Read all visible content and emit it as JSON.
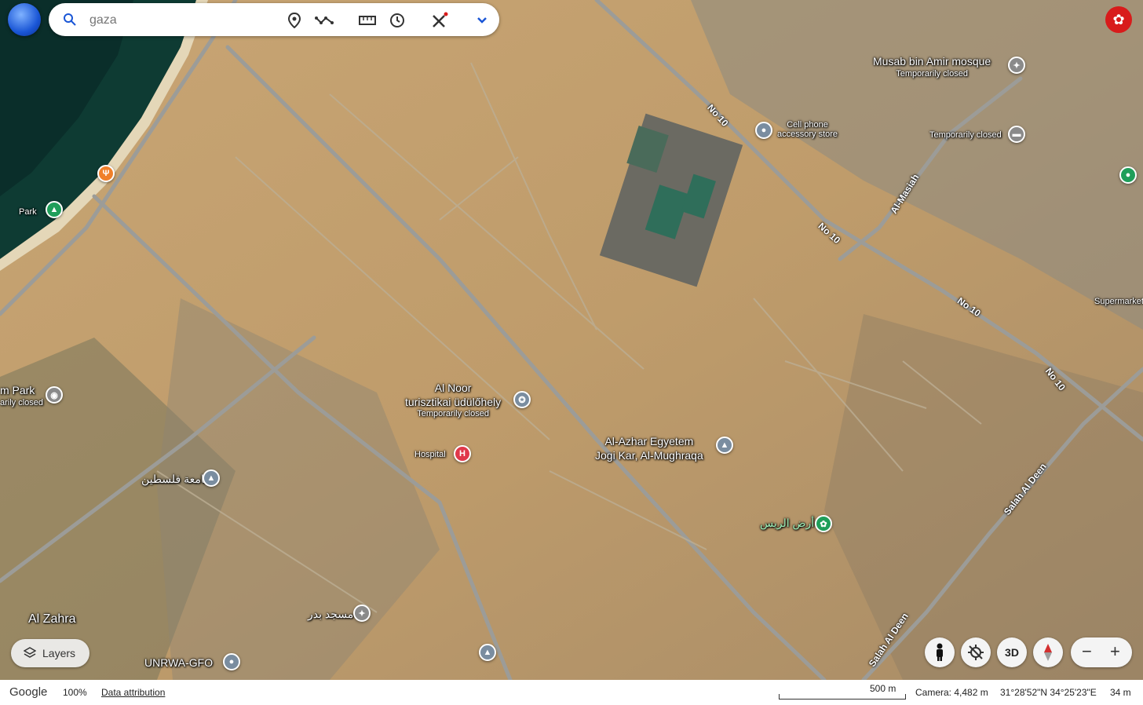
{
  "search": {
    "value": "",
    "placeholder": "gaza"
  },
  "toolbar": {
    "icons": [
      "search-icon",
      "place-pin-icon",
      "path-icon",
      "measure-ruler-icon",
      "history-icon",
      "tools-icon",
      "chevron-down-icon"
    ]
  },
  "account": {
    "avatar_color": "#d81b1b"
  },
  "map": {
    "labels": {
      "musab_mosque": "Musab bin Amir mosque",
      "musab_status": "Temporarily closed",
      "cell_phone_1": "Cell phone",
      "cell_phone_2": "accessory store",
      "temp_closed_2": "Temporarily closed",
      "park": "Park",
      "park_left": "m Park",
      "park_left_status": "arily closed",
      "al_noor_1": "Al Noor",
      "al_noor_2": "turisztikai üdülőhely",
      "al_noor_status": "Temporarily closed",
      "hospital": "Hospital",
      "al_azhar_1": "Al-Azhar Egyetem",
      "al_azhar_2": "Jogi Kar, Al-Mughraqa",
      "palestine_uni": "جامعة فلسطين",
      "ard_alrayyis": "أرض الريس",
      "masjid_badr": "مسجد بدر",
      "al_zahra": "Al Zahra",
      "unrwa": "UNRWA-GFO",
      "supermarket": "Supermarket"
    },
    "roads": {
      "no10_a": "No 10",
      "no10_b": "No 10",
      "no10_c": "No 10",
      "no10_d": "No 10",
      "al_masiah": "Al-Masiah",
      "salah_1": "Salah Al Deen",
      "salah_2": "Salah Al Deen"
    },
    "colors": {
      "sea": "#0e3b33",
      "sand": "#c9a676",
      "road": "#9c9c98",
      "mosque_pin": "#8a8a8a",
      "hospital_pin": "#e0384a",
      "food_pin": "#f0802a",
      "park_pin": "#1f9e5a",
      "school_pin": "#7a8da0"
    }
  },
  "controls": {
    "layers_label": "Layers",
    "view_3d": "3D",
    "zoom_out": "−",
    "zoom_in": "+"
  },
  "status": {
    "brand": "Google",
    "zoom": "100%",
    "attribution": "Data attribution",
    "scale": "500 m",
    "camera": "Camera: 4,482 m",
    "coords": "31°28'52\"N 34°25'23\"E",
    "elevation": "34 m"
  }
}
